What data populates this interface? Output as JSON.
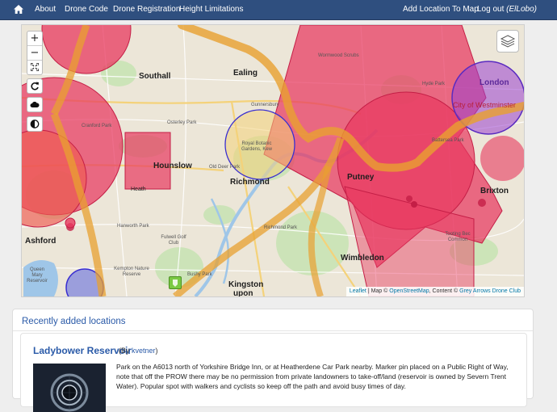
{
  "nav": {
    "about": "About",
    "drone_code": "Drone Code",
    "drone_registration": "Drone Registration",
    "height_limitations": "Height Limitations",
    "add_location": "Add Location To Map",
    "logout": "Log out",
    "username": "(ElLobo)"
  },
  "map": {
    "zoom_in": "+",
    "zoom_out": "−",
    "attribution": {
      "leaflet": "Leaflet",
      "map_prefix": " | Map © ",
      "osm": "OpenStreetMap",
      "content_prefix": ", Content © ",
      "club": "Grey Arrows Drone Club"
    },
    "labels": {
      "southall": "Southall",
      "ealing": "Ealing",
      "hounslow": "Hounslow",
      "richmond": "Richmond",
      "ashford": "Ashford",
      "putney": "Putney",
      "wimbledon": "Wimbledon",
      "brixton": "Brixton",
      "kingston": "Kingston",
      "upon": "upon",
      "london": "London",
      "westminster": "City of Westminster",
      "heath": "Heath",
      "osterley": "Osterley Park",
      "kew": "Royal Botanic Gardens, Kew",
      "old_deer": "Old Deer Park",
      "hanworth": "Hanworth Park",
      "fulwell": "Fulwell Golf Club",
      "kempton": "Kempton Nature Reserve",
      "bushy": "Bushy Park",
      "richmond_park": "Richmond Park",
      "queen_mary": "Queen Mary Reservoir",
      "tooting": "Tooting Bec Common",
      "gunnersbury": "Gunnersbury",
      "cranford": "Cranford Park",
      "hyde_park": "Hyde Park",
      "battersea": "Battersea Park",
      "scrubs": "Wormwood Scrubs"
    }
  },
  "recent": {
    "title": "Recently added locations",
    "location": {
      "name": "Ladybower Reservoir",
      "by_prefix": "(By ",
      "user": "kvetner",
      "by_suffix": ")",
      "description": "Park on the A6013 north of Yorkshire Bridge Inn, or at Heatherdene Car Park nearby. Marker pin placed on a Public Right of Way, note that off the PROW there may be no permission from private landowners to take-off/land (reservoir is owned by Severn Trent Water). Popular spot with walkers and cyclists so keep off the path and avoid busy times of day."
    }
  }
}
